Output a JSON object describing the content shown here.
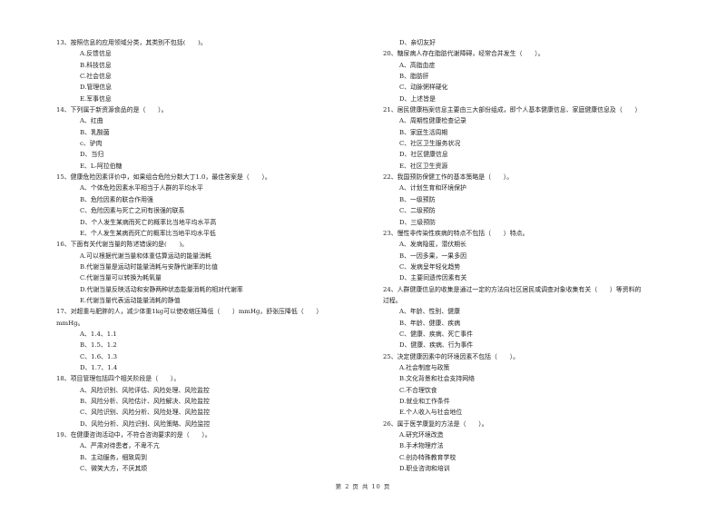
{
  "left_column": [
    {
      "type": "q",
      "text": "13、按照信息的应用领域分类，其类别不包括(　　)。"
    },
    {
      "type": "opt",
      "text": "A.反馈信息"
    },
    {
      "type": "opt",
      "text": "B.科技信息"
    },
    {
      "type": "opt",
      "text": "C.社会信息"
    },
    {
      "type": "opt",
      "text": "D.管理信息"
    },
    {
      "type": "opt",
      "text": "E.军事信息"
    },
    {
      "type": "q",
      "text": "14、下列属于新资源食品的是（　　）。"
    },
    {
      "type": "opt",
      "text": "A、红曲"
    },
    {
      "type": "opt",
      "text": "B、乳酸菌"
    },
    {
      "type": "opt",
      "text": "c、驴肉"
    },
    {
      "type": "opt",
      "text": "D、当归"
    },
    {
      "type": "opt",
      "text": "E、L-阿拉伯糖"
    },
    {
      "type": "q",
      "text": "15、健康危险因素评价中，如果组合危险分数大丁1.0，最佳答案是（　　）。"
    },
    {
      "type": "opt",
      "text": "A、个体危险因素水平相当于人群的平均水平"
    },
    {
      "type": "opt",
      "text": "B、危险因素的联合作用强"
    },
    {
      "type": "opt",
      "text": "C、危险因素与死亡之间有很强的联系"
    },
    {
      "type": "opt",
      "text": "D、个人发生某病而死亡的概率比当地平均水平高"
    },
    {
      "type": "opt",
      "text": "E、个人发生某病而死亡的概率比当地平均水平低"
    },
    {
      "type": "q",
      "text": "16、下面有关代谢当量的陈述错误的是(　　)。"
    },
    {
      "type": "opt",
      "text": "A.可以根据代谢当量和体重估算运动的能量消耗"
    },
    {
      "type": "opt",
      "text": "B.代谢当量是运动时能量消耗与安静代谢率的比值"
    },
    {
      "type": "opt",
      "text": "C.代谢当量可以转换为耗氧量"
    },
    {
      "type": "opt",
      "text": "D.代谢当量反映活动和安静两种状态能量消耗的相对代谢率"
    },
    {
      "type": "opt",
      "text": "E.代谢当量代表运动能量消耗的静值"
    },
    {
      "type": "q",
      "text": "17、对超重与肥胖的人，减少体重1kg可以使收缩压降低（　　）mmHg，舒张压降低（　　）"
    },
    {
      "type": "q",
      "text": "mmHg。"
    },
    {
      "type": "opt",
      "text": "A、1.4、1.1"
    },
    {
      "type": "opt",
      "text": "B、1.5、1.2"
    },
    {
      "type": "opt",
      "text": "C、1.6、1.3"
    },
    {
      "type": "opt",
      "text": "D、1.7、1.4"
    },
    {
      "type": "q",
      "text": "18、项目管理包括四个相关阶段是（　　）。"
    },
    {
      "type": "opt",
      "text": "A、风险识别、风险评估、风险处理、风险监控"
    },
    {
      "type": "opt",
      "text": "B、风险分析、风险估计、风险解决、风险监控"
    },
    {
      "type": "opt",
      "text": "C、风险识别、风险分析、风险处理、风险监控"
    },
    {
      "type": "opt",
      "text": "D、风险分析、风险识别、风险策略、风险监控"
    },
    {
      "type": "q",
      "text": "19、在健康咨询活动中，不符合咨询要求的是（　　）。"
    },
    {
      "type": "opt",
      "text": "A、严肃对待患者，不卑不亢"
    },
    {
      "type": "opt",
      "text": "B、主动服务，细致周到"
    },
    {
      "type": "opt",
      "text": "C、微笑大方，不厌其烦"
    }
  ],
  "right_column": [
    {
      "type": "opt",
      "text": "D、亲切友好"
    },
    {
      "type": "q",
      "text": "20、糖尿病人存在脂肪代谢障碍，经常合并发生（　　）。"
    },
    {
      "type": "opt",
      "text": "A、高脂血症"
    },
    {
      "type": "opt",
      "text": "B、脂肪肝"
    },
    {
      "type": "opt",
      "text": "C、动脉粥样硬化"
    },
    {
      "type": "opt",
      "text": "D、上述皆是"
    },
    {
      "type": "q",
      "text": "21、居民健康档案信息主要由三大部份组成，即个人基本健康信息、家庭健康信息及（　　）"
    },
    {
      "type": "opt",
      "text": "A、周期性健康检查记录"
    },
    {
      "type": "opt",
      "text": "B、家庭生活周期"
    },
    {
      "type": "opt",
      "text": "C、社区卫生服务状况"
    },
    {
      "type": "opt",
      "text": "D、社区健康信息"
    },
    {
      "type": "opt",
      "text": "E、社区卫生资源"
    },
    {
      "type": "q",
      "text": "22、我国预防保健工作的基本策略是（　　）。"
    },
    {
      "type": "opt",
      "text": "A、计划生育和环境保护"
    },
    {
      "type": "opt",
      "text": "B、一级预防"
    },
    {
      "type": "opt",
      "text": "C、二级预防"
    },
    {
      "type": "opt",
      "text": "D、三级预防"
    },
    {
      "type": "q",
      "text": "23、慢性非传染性疾病的特点不包括（　　）特点。"
    },
    {
      "type": "opt",
      "text": "A、发病隐匿，潜伏期长"
    },
    {
      "type": "opt",
      "text": "B、一因多果，一果多因"
    },
    {
      "type": "opt",
      "text": "C、发病呈年轻化趋势"
    },
    {
      "type": "opt",
      "text": "D、主要同遗传因素有关"
    },
    {
      "type": "q",
      "text": "24、人群健康信息的收集是通过一定的方法向社区居民或调查对象收集有关（　　）等资料的"
    },
    {
      "type": "q",
      "text": "过程。"
    },
    {
      "type": "opt",
      "text": "A、年龄、性别、健康"
    },
    {
      "type": "opt",
      "text": "B、年龄、健康、疾病"
    },
    {
      "type": "opt",
      "text": "C、健康、疾病、死亡事件"
    },
    {
      "type": "opt",
      "text": "D、健康、疾病、行为事件"
    },
    {
      "type": "q",
      "text": "25、决定健康因素中的环境因素不包括（　　）。"
    },
    {
      "type": "opt",
      "text": "A.社会制度与政策"
    },
    {
      "type": "opt",
      "text": "B.文化背景和社会支持网络"
    },
    {
      "type": "opt",
      "text": "C.不合理饮食"
    },
    {
      "type": "opt",
      "text": "D.就业和工作条件"
    },
    {
      "type": "opt",
      "text": "E.个人收入与社会地位"
    },
    {
      "type": "q",
      "text": "26、属于医学康复的方法是（　　）。"
    },
    {
      "type": "opt",
      "text": "A.研究环境改造"
    },
    {
      "type": "opt",
      "text": "B.手术物理疗法"
    },
    {
      "type": "opt",
      "text": "C.创办特殊教育学校"
    },
    {
      "type": "opt",
      "text": "D.职业咨询和培训"
    }
  ],
  "footer": {
    "page_label": "第 2 页 共 10 页"
  }
}
